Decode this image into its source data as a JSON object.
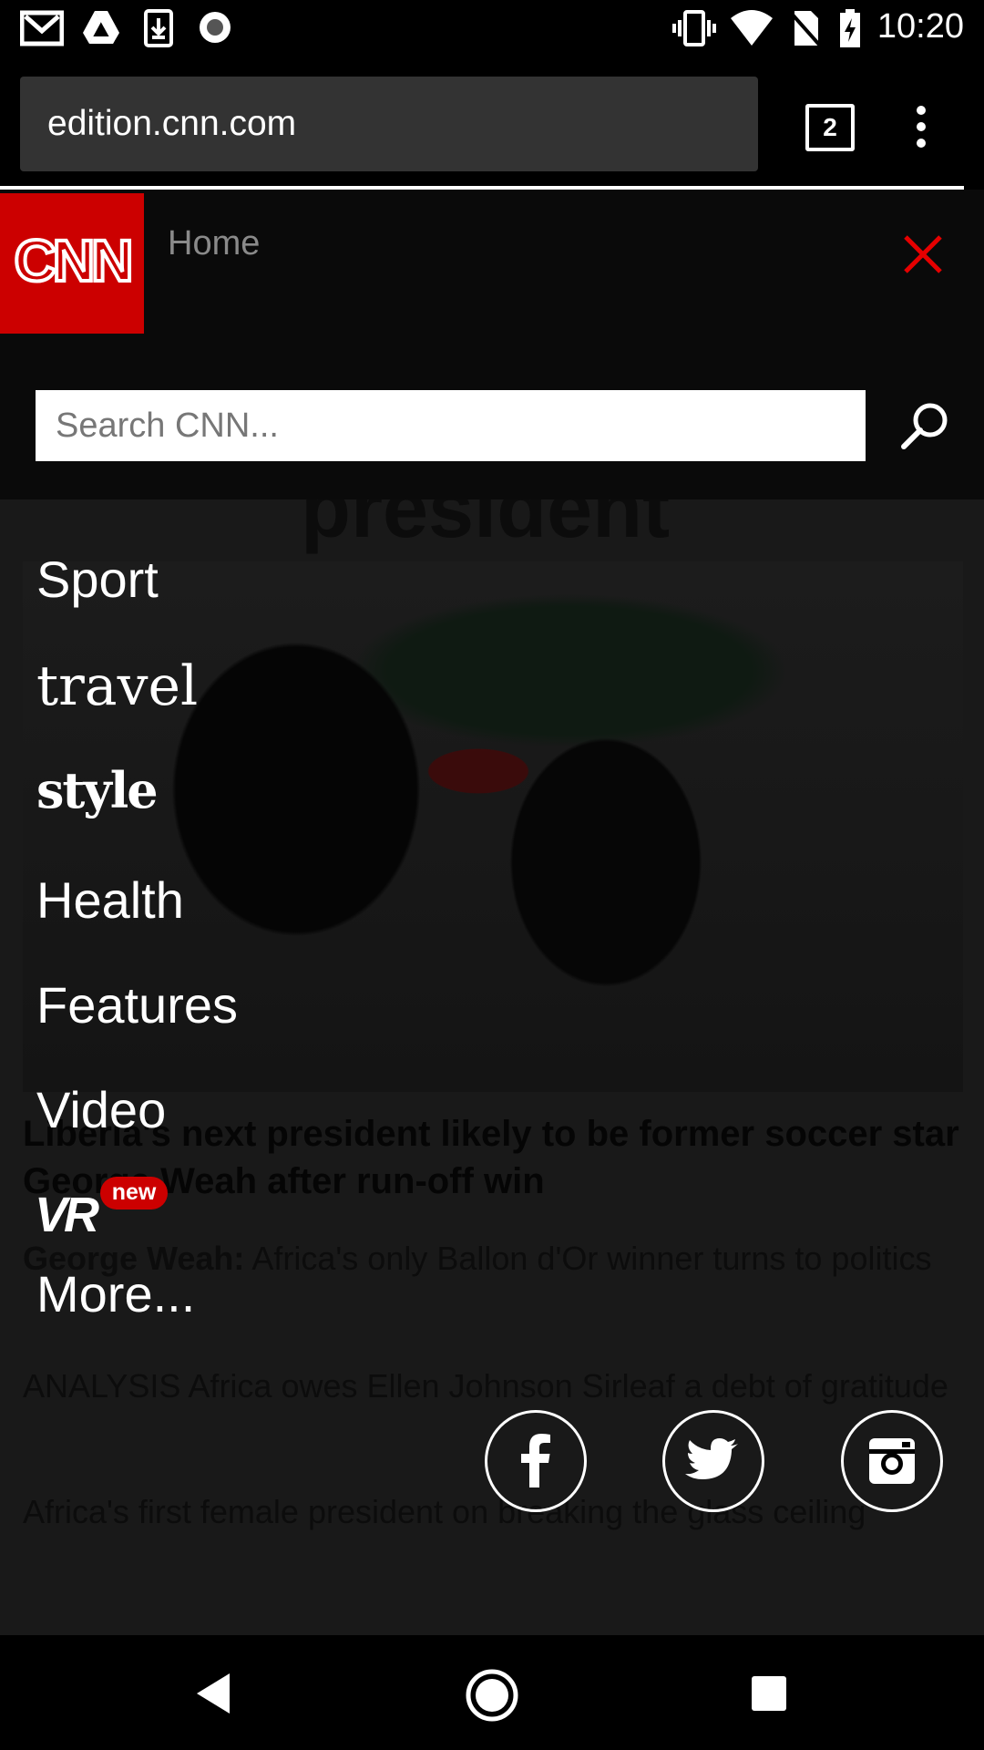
{
  "status_bar": {
    "time": "10:20",
    "icons": [
      "gmail-icon",
      "drive-icon",
      "download-icon",
      "record-icon",
      "vibrate-icon",
      "wifi-icon",
      "no-sim-icon",
      "battery-charging-icon"
    ]
  },
  "browser": {
    "url": "edition.cnn.com",
    "tab_count": "2",
    "menu_icon": "more-vert-icon"
  },
  "nav": {
    "logo_text": "CNN",
    "home_label": "Home",
    "close_icon": "close-icon",
    "search_placeholder": "Search CNN...",
    "search_icon": "search-icon",
    "items": [
      {
        "label": "Sport"
      },
      {
        "label": "travel"
      },
      {
        "label": "style"
      },
      {
        "label": "Health"
      },
      {
        "label": "Features"
      },
      {
        "label": "Video"
      },
      {
        "label": "VR",
        "badge": "new"
      },
      {
        "label": "More..."
      }
    ],
    "social": [
      "facebook-icon",
      "twitter-icon",
      "instagram-icon"
    ]
  },
  "background_article": {
    "headline_fragment": "president",
    "headline": "Liberia's next president likely to be former soccer star George Weah after run-off win",
    "sub1_bold": "George Weah:",
    "sub1": "Africa's only Ballon d'Or winner turns to politics",
    "sub2": "ANALYSIS Africa owes Ellen Johnson Sirleaf a debt of gratitude",
    "sub3": "Africa's first female president on breaking the glass ceiling"
  },
  "system_nav": {
    "icons": [
      "back-icon",
      "home-icon",
      "recents-icon"
    ]
  },
  "colors": {
    "brand_red": "#cc0000",
    "menu_bg": "#0a0a0a",
    "url_box": "#333333"
  }
}
